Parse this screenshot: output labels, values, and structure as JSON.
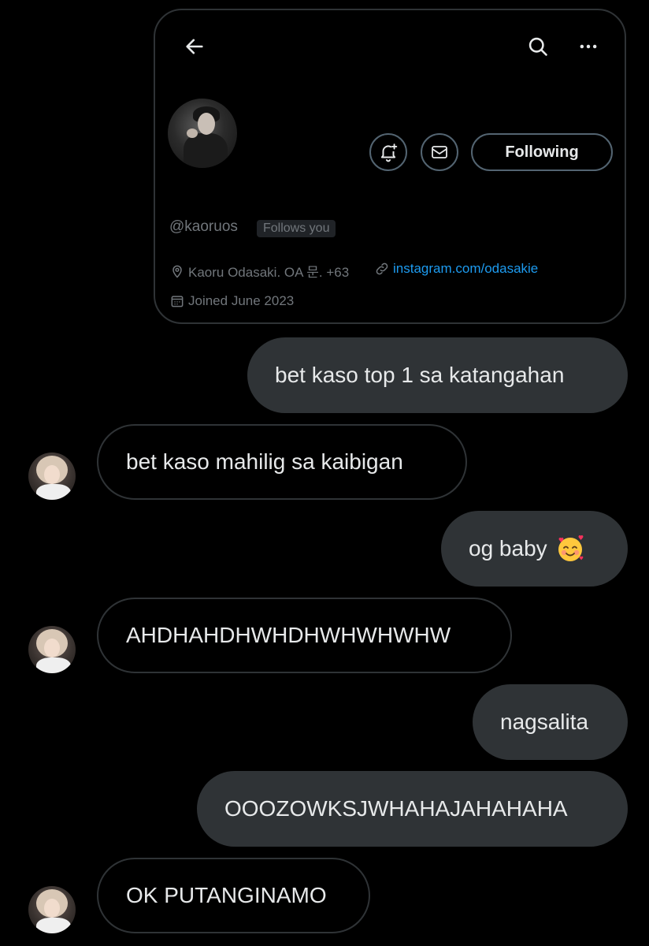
{
  "profile": {
    "handle": "@kaoruos",
    "follows_badge": "Follows you",
    "location": "Kaoru Odasaki. OA 문. +63",
    "link": "instagram.com/odasakie",
    "joined": "Joined June 2023",
    "following_label": "Following"
  },
  "icons": {
    "back": "arrow-left-icon",
    "search": "search-icon",
    "more": "more-dots-icon",
    "notify": "bell-plus-icon",
    "mail": "envelope-icon",
    "location": "location-pin-icon",
    "link": "link-icon",
    "calendar": "calendar-icon",
    "emoji": "smiling-face-with-hearts-emoji"
  },
  "messages": [
    {
      "side": "sent",
      "text": "bet kaso top 1 sa katangahan"
    },
    {
      "side": "received",
      "text": "bet kaso mahilig sa kaibigan"
    },
    {
      "side": "sent",
      "text": "og baby"
    },
    {
      "side": "received",
      "text": "AHDHAHDHWHDHWHWHWHW"
    },
    {
      "side": "sent",
      "text": "nagsalita"
    },
    {
      "side": "sent",
      "text": "OOOZOWKSJWHAHAJAHAHAHA"
    },
    {
      "side": "received",
      "text": "OK PUTANGINAMO"
    }
  ],
  "colors": {
    "background": "#000000",
    "sent_bubble": "#2f3336",
    "received_border": "#2f3336",
    "text": "#e7e9ea",
    "muted": "#71767b",
    "link": "#1d9bf0"
  }
}
